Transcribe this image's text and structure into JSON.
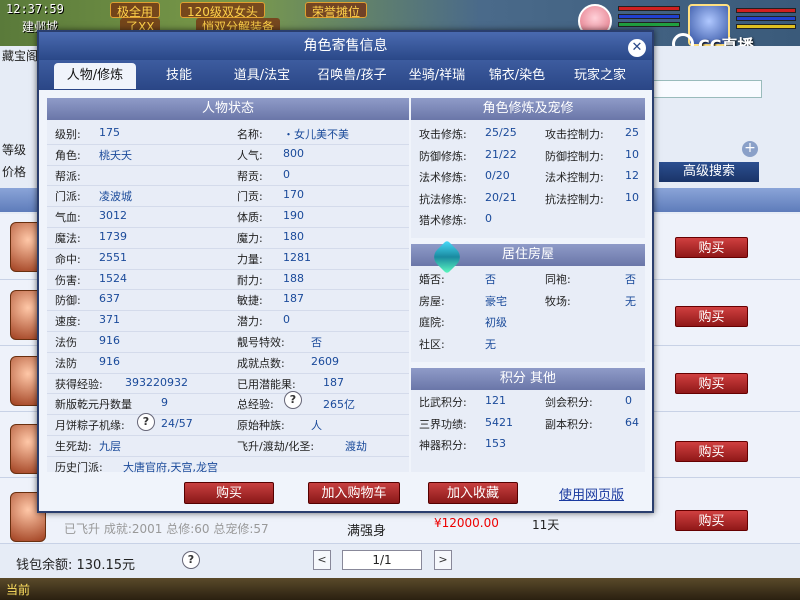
{
  "hud": {
    "clock": "12:37:59",
    "city": "建邺城",
    "banners": [
      "极全用",
      "120级双女头",
      "荣誉摊位",
      "了XX",
      "悄双分解装备"
    ],
    "cc_logo_text": "CC直播"
  },
  "shop": {
    "left_labels": [
      "藏宝阁",
      "等级",
      "价格"
    ],
    "advanced_search": "高级搜索",
    "buy_label": "购买",
    "plus": "+",
    "bottom_row": {
      "text": "已飞升  成就:2001  总修:60  总宠修:57",
      "name": "满强身",
      "price": "¥12000.00",
      "days": "11天"
    },
    "wallet": "钱包余额: 130.15元",
    "page": "1/1",
    "prev": "<",
    "next": ">",
    "help": "?",
    "taskbar_current": "当前"
  },
  "dialog": {
    "title": "角色寄售信息",
    "close": "✕",
    "tabs": [
      {
        "label": "人物/修炼",
        "active": true
      },
      {
        "label": "技能"
      },
      {
        "label": "道具/法宝"
      },
      {
        "label": "召唤兽/孩子"
      },
      {
        "label": "坐骑/祥瑞"
      },
      {
        "label": "锦衣/染色"
      },
      {
        "label": "玩家之家"
      }
    ],
    "status_header": "人物状态",
    "cultivation_header": "角色修炼及宠修",
    "house_header": "居住房屋",
    "points_header": "积分 其他",
    "status_left": [
      {
        "k": "级别:",
        "v": "175"
      },
      {
        "k": "角色:",
        "v": "桃夭夭"
      },
      {
        "k": "帮派:",
        "v": ""
      },
      {
        "k": "门派:",
        "v": "凌波城"
      },
      {
        "k": "气血:",
        "v": "3012"
      },
      {
        "k": "魔法:",
        "v": "1739"
      },
      {
        "k": "命中:",
        "v": "2551"
      },
      {
        "k": "伤害:",
        "v": "1524"
      },
      {
        "k": "防御:",
        "v": "637"
      },
      {
        "k": "速度:",
        "v": "371"
      },
      {
        "k": "法伤",
        "v": "916"
      },
      {
        "k": "法防",
        "v": "916"
      },
      {
        "k": "获得经验:",
        "v": "393220932"
      },
      {
        "k": "新版乾元丹数量",
        "v": "9"
      },
      {
        "k": "月饼粽子机缘:",
        "v": "24/57"
      },
      {
        "k": "生死劫:",
        "v": "九层"
      },
      {
        "k": "历史门派:",
        "v": "大唐官府,天宫,龙宫"
      }
    ],
    "status_right": [
      {
        "k": "名称:",
        "v": "・女儿美不美"
      },
      {
        "k": "人气:",
        "v": "800"
      },
      {
        "k": "帮贡:",
        "v": "0"
      },
      {
        "k": "门贡:",
        "v": "170"
      },
      {
        "k": "体质:",
        "v": "190"
      },
      {
        "k": "魔力:",
        "v": "180"
      },
      {
        "k": "力量:",
        "v": "1281"
      },
      {
        "k": "耐力:",
        "v": "188"
      },
      {
        "k": "敏捷:",
        "v": "187"
      },
      {
        "k": "潜力:",
        "v": "0"
      },
      {
        "k": "靓号特效:",
        "v": "否"
      },
      {
        "k": "成就点数:",
        "v": "2609"
      },
      {
        "k": "已用潜能果:",
        "v": "187"
      },
      {
        "k": "总经验:",
        "v": "265亿"
      },
      {
        "k": "原始种族:",
        "v": "人"
      },
      {
        "k": "飞升/渡劫/化圣:",
        "v": "渡劫"
      }
    ],
    "cultivation": [
      {
        "k1": "攻击修炼:",
        "v1": "25/25",
        "k2": "攻击控制力:",
        "v2": "25"
      },
      {
        "k1": "防御修炼:",
        "v1": "21/22",
        "k2": "防御控制力:",
        "v2": "10"
      },
      {
        "k1": "法术修炼:",
        "v1": "0/20",
        "k2": "法术控制力:",
        "v2": "12"
      },
      {
        "k1": "抗法修炼:",
        "v1": "20/21",
        "k2": "抗法控制力:",
        "v2": "10"
      },
      {
        "k1": "猎术修炼:",
        "v1": "0",
        "k2": "",
        "v2": ""
      }
    ],
    "house": [
      {
        "k1": "婚否:",
        "v1": "否",
        "k2": "同袍:",
        "v2": "否"
      },
      {
        "k1": "房屋:",
        "v1": "豪宅",
        "k2": "牧场:",
        "v2": "无"
      },
      {
        "k1": "庭院:",
        "v1": "初级",
        "k2": "",
        "v2": ""
      },
      {
        "k1": "社区:",
        "v1": "无",
        "k2": "",
        "v2": ""
      }
    ],
    "points": [
      {
        "k1": "比武积分:",
        "v1": "121",
        "k2": "剑会积分:",
        "v2": "0"
      },
      {
        "k1": "三界功绩:",
        "v1": "5421",
        "k2": "副本积分:",
        "v2": "64"
      },
      {
        "k1": "神器积分:",
        "v1": "153",
        "k2": "",
        "v2": ""
      }
    ],
    "buttons": {
      "buy": "购买",
      "add_cart": "加入购物车",
      "add_fav": "加入收藏",
      "web_link": "使用网页版"
    }
  }
}
